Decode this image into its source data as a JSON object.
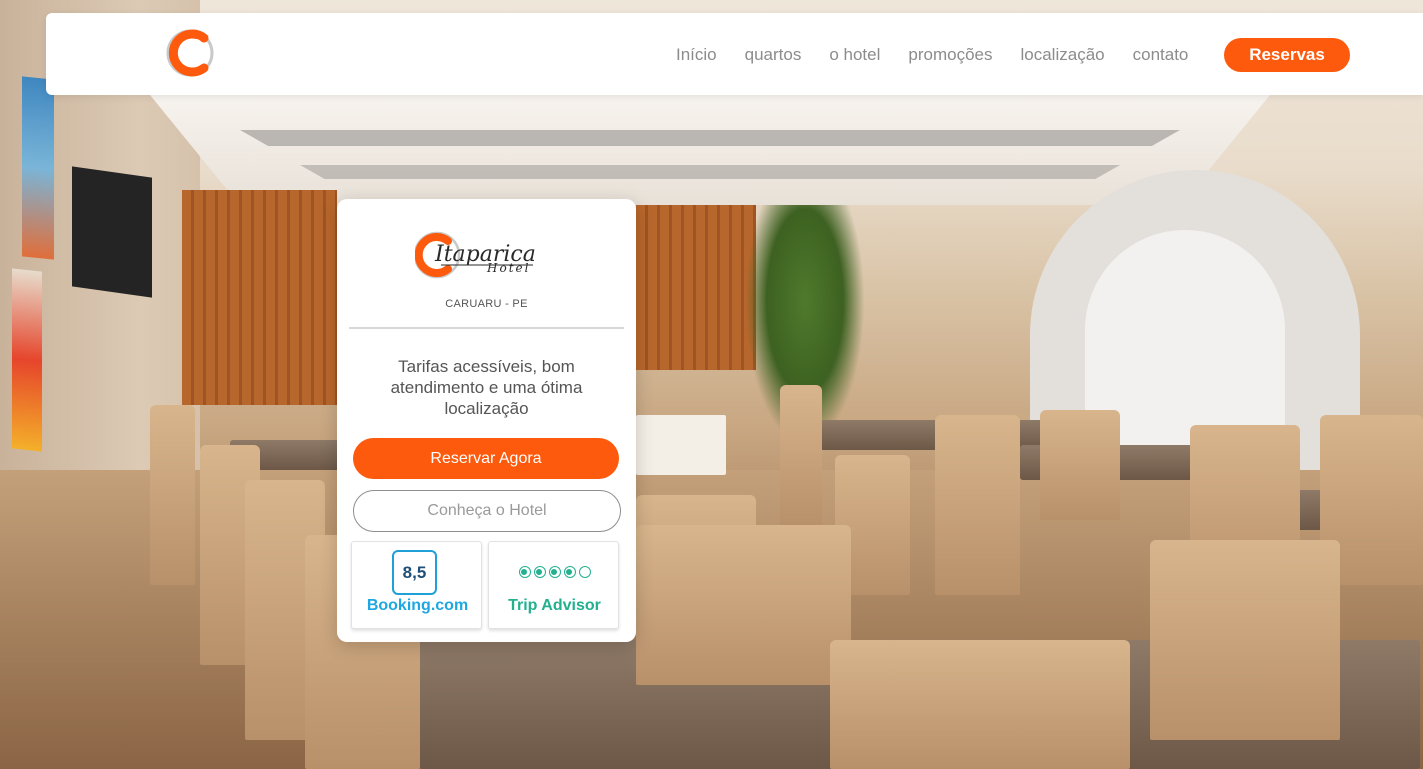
{
  "navbar": {
    "logo_icon": "itaparica-c-logo-icon",
    "links": [
      {
        "label": "Início"
      },
      {
        "label": "quartos"
      },
      {
        "label": "o hotel"
      },
      {
        "label": "promoções"
      },
      {
        "label": "localização"
      },
      {
        "label": "contato"
      }
    ],
    "reserve_label": "Reservas"
  },
  "card": {
    "logo_icon": "itaparica-hotel-logo-icon",
    "location": "CARUARU - PE",
    "tagline": "Tarifas acessíveis, bom atendimento e uma ótima localização",
    "book_now_label": "Reservar Agora",
    "know_hotel_label": "Conheça o Hotel",
    "booking": {
      "score": "8,5",
      "name": "Booking.com"
    },
    "tripadvisor": {
      "rating": 4,
      "max_rating": 5,
      "name": "Trip Advisor"
    }
  },
  "colors": {
    "accent": "#fd5a0d",
    "booking_blue": "#1ea7e0",
    "tripadvisor_green": "#22b08e",
    "nav_text": "#8c8c8c"
  },
  "background": {
    "image": "hotel-breakfast-room-photo"
  }
}
